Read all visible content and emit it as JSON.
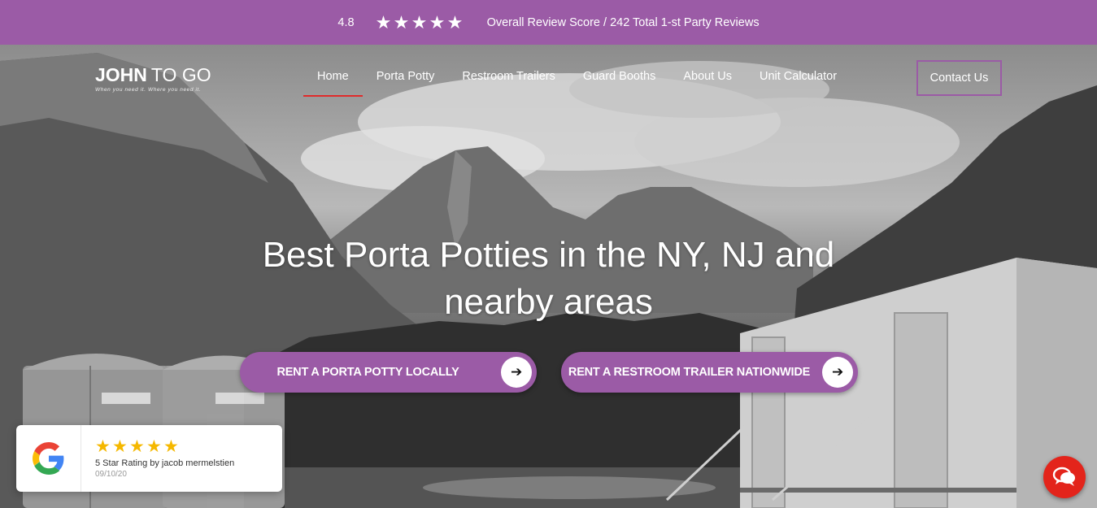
{
  "review_bar": {
    "score": "4.8",
    "stars": [
      "★",
      "★",
      "★",
      "★",
      "★"
    ],
    "summary": "Overall Review Score / 242 Total 1-st Party Reviews"
  },
  "brand": {
    "logo_bold": "JOHN",
    "logo_light": "TO GO",
    "tagline": "When you need it. Where you need it."
  },
  "nav": {
    "items": [
      {
        "label": "Home",
        "active": true
      },
      {
        "label": "Porta Potty"
      },
      {
        "label": "Restroom Trailers"
      },
      {
        "label": "Guard Booths"
      },
      {
        "label": "About Us"
      },
      {
        "label": "Unit Calculator"
      }
    ],
    "contact_label": "Contact Us"
  },
  "hero": {
    "headline_line1": "Best Porta Potties in the NY, NJ and",
    "headline_line2": "nearby areas",
    "cta_local": "RENT A PORTA POTTY LOCALLY",
    "cta_nationwide": "RENT A RESTROOM TRAILER NATIONWIDE",
    "arrow_icon": "arrow-right-icon"
  },
  "google_review": {
    "stars": [
      "★",
      "★",
      "★",
      "★",
      "★"
    ],
    "rating_text_bold": "5 Star Rating",
    "rating_by": " by jacob mermelstien",
    "date": "09/10/20"
  },
  "colors": {
    "brand_purple": "#9b5ba6",
    "active_underline": "#e02b2b",
    "chat_red": "#e3241b",
    "star_gold": "#f5b800"
  }
}
